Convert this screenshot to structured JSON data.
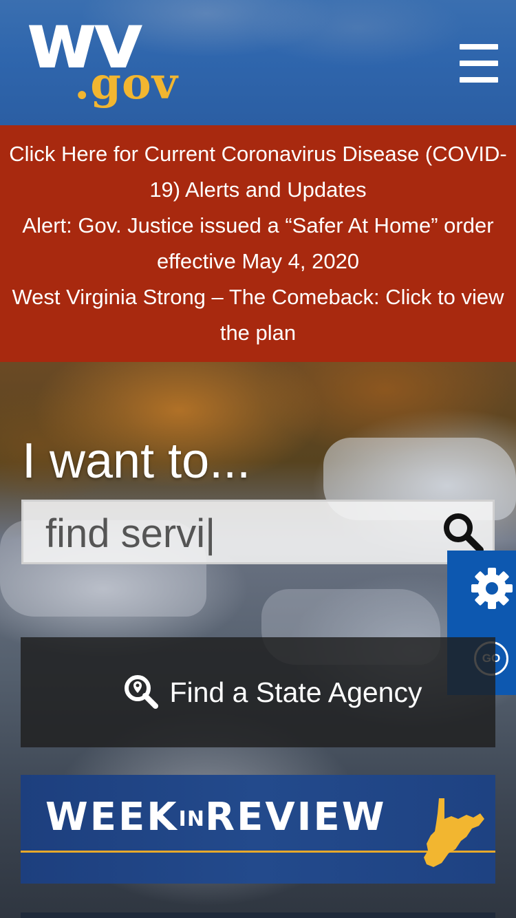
{
  "header": {
    "logo_main": "wv",
    "logo_sub": ".gov",
    "menu_icon": "hamburger-menu-icon"
  },
  "alerts": {
    "line1": "Click Here for Current Coronavirus Disease (COVID-19) Alerts and Updates",
    "line2a": "Alert: Gov. Justice issued a “Safer At Home” order",
    "line2b": "effective May 4, 2020",
    "line3": "West Virginia Strong – The Comeback: Click to view the plan"
  },
  "hero": {
    "heading": "I want to...",
    "search": {
      "value": "find servi|",
      "icon": "search-icon"
    },
    "side_tab": {
      "settings_icon": "gear-icon",
      "go_label": "GO"
    },
    "agency_button": {
      "label": "Find a State Agency",
      "icon": "location-search-icon"
    },
    "week_in_review": {
      "word1": "WEEK",
      "word2": "IN",
      "word3": "REVIEW"
    }
  },
  "colors": {
    "header_blue": "#2f66ad",
    "alert_red": "#a8290f",
    "gold": "#f2b630",
    "side_tab_blue": "#0d58b0"
  }
}
